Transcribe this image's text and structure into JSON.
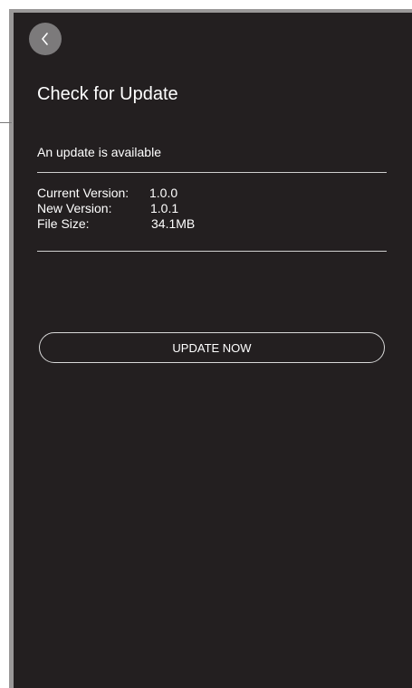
{
  "header": {
    "back_icon": "chevron-left-icon",
    "title": "Check for Update"
  },
  "update": {
    "status": "An update is available",
    "rows": [
      {
        "label": "Current Version:",
        "value": "1.0.0"
      },
      {
        "label": "New Version:",
        "value": "1.0.1"
      },
      {
        "label": "File Size:",
        "value": "34.1MB"
      }
    ],
    "button_label": "UPDATE NOW"
  },
  "colors": {
    "background": "#231f20",
    "back_button": "#7c7a7b",
    "text": "#ffffff",
    "divider": "#cfcfcf"
  }
}
